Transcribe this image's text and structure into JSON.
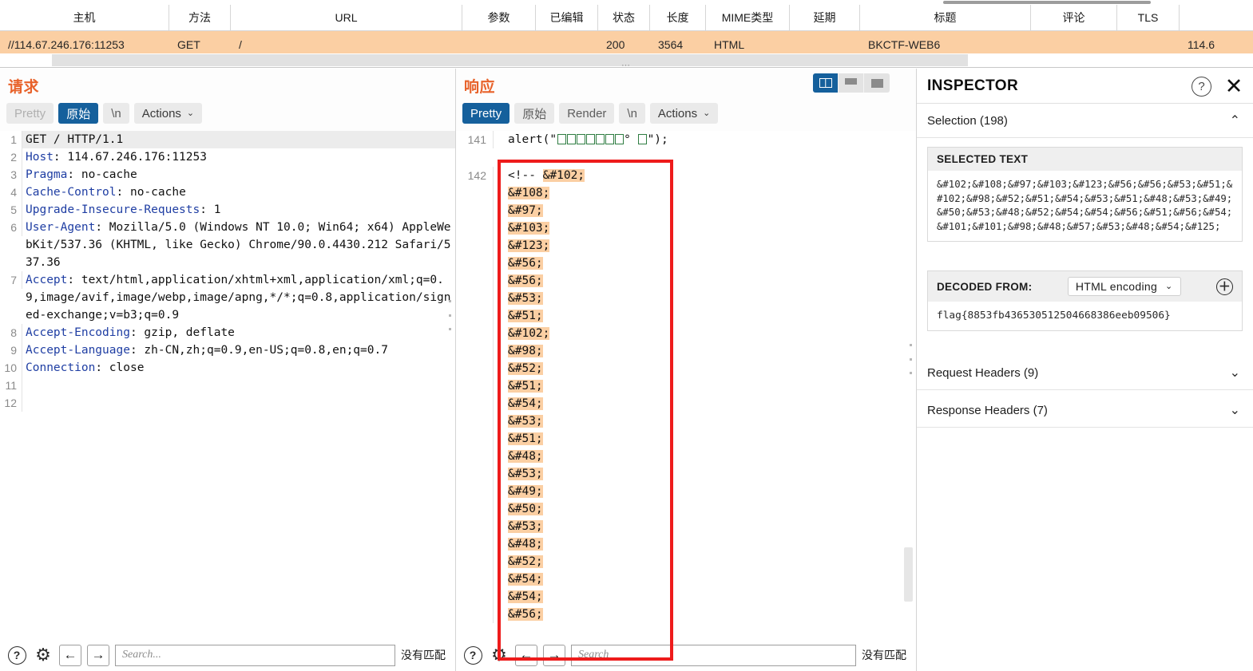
{
  "proxy_table": {
    "columns": [
      {
        "key": "host",
        "label": "主机"
      },
      {
        "key": "method",
        "label": "方法"
      },
      {
        "key": "url",
        "label": "URL"
      },
      {
        "key": "params",
        "label": "参数"
      },
      {
        "key": "edited",
        "label": "已编辑"
      },
      {
        "key": "status",
        "label": "状态"
      },
      {
        "key": "length",
        "label": "长度"
      },
      {
        "key": "mime",
        "label": "MIME类型"
      },
      {
        "key": "delay",
        "label": "延期"
      },
      {
        "key": "title",
        "label": "标题"
      },
      {
        "key": "comment",
        "label": "评论"
      },
      {
        "key": "tls",
        "label": "TLS"
      },
      {
        "key": "ip",
        "label": ""
      }
    ],
    "rows": [
      {
        "host": "//114.67.246.176:11253",
        "method": "GET",
        "url": "/",
        "params": "",
        "edited": "",
        "status": "200",
        "length": "3564",
        "mime": "HTML",
        "delay": "",
        "title": "BKCTF-WEB6",
        "comment": "",
        "tls": "",
        "ip": "114.6"
      }
    ]
  },
  "request_pane": {
    "title": "请求",
    "tabs": [
      {
        "label": "Pretty",
        "state": "dim"
      },
      {
        "label": "原始",
        "state": "active"
      },
      {
        "label": "\\n",
        "state": "normal"
      },
      {
        "label": "Actions",
        "state": "normal",
        "caret": "⌄"
      }
    ],
    "lines": [
      {
        "n": "1",
        "highlight": true,
        "segments": [
          {
            "t": "GET / HTTP/1.1",
            "cls": "plain"
          }
        ]
      },
      {
        "n": "2",
        "highlight": false,
        "segments": [
          {
            "t": "Host",
            "cls": "key"
          },
          {
            "t": ": 114.67.246.176:11253",
            "cls": "plain"
          }
        ]
      },
      {
        "n": "3",
        "highlight": false,
        "segments": [
          {
            "t": "Pragma",
            "cls": "key"
          },
          {
            "t": ": no-cache",
            "cls": "plain"
          }
        ]
      },
      {
        "n": "4",
        "highlight": false,
        "segments": [
          {
            "t": "Cache-Control",
            "cls": "key"
          },
          {
            "t": ": no-cache",
            "cls": "plain"
          }
        ]
      },
      {
        "n": "5",
        "highlight": false,
        "segments": [
          {
            "t": "Upgrade-Insecure-Requests",
            "cls": "key"
          },
          {
            "t": ": 1",
            "cls": "plain"
          }
        ]
      },
      {
        "n": "6",
        "highlight": false,
        "segments": [
          {
            "t": "User-Agent",
            "cls": "key"
          },
          {
            "t": ": Mozilla/5.0 (Windows NT 10.0; Win64; x64) AppleWebKit/537.36 (KHTML, like Gecko) Chrome/90.0.4430.212 Safari/537.36",
            "cls": "plain"
          }
        ]
      },
      {
        "n": "7",
        "highlight": false,
        "segments": [
          {
            "t": "Accept",
            "cls": "key"
          },
          {
            "t": ": text/html,application/xhtml+xml,application/xml;q=0.9,image/avif,image/webp,image/apng,*/*;q=0.8,application/signed-exchange;v=b3;q=0.9",
            "cls": "plain"
          }
        ]
      },
      {
        "n": "8",
        "highlight": false,
        "segments": [
          {
            "t": "Accept-Encoding",
            "cls": "key"
          },
          {
            "t": ": gzip, deflate",
            "cls": "plain"
          }
        ]
      },
      {
        "n": "9",
        "highlight": false,
        "segments": [
          {
            "t": "Accept-Language",
            "cls": "key"
          },
          {
            "t": ": zh-CN,zh;q=0.9,en-US;q=0.8,en;q=0.7",
            "cls": "plain"
          }
        ]
      },
      {
        "n": "10",
        "highlight": false,
        "segments": [
          {
            "t": "Connection",
            "cls": "key"
          },
          {
            "t": ": close",
            "cls": "plain"
          }
        ]
      },
      {
        "n": "11",
        "highlight": false,
        "segments": [
          {
            "t": "",
            "cls": "plain"
          }
        ]
      },
      {
        "n": "12",
        "highlight": false,
        "segments": [
          {
            "t": "",
            "cls": "plain"
          }
        ]
      }
    ],
    "search": {
      "placeholder": "Search...",
      "no_match_label": "没有匹配",
      "prev_icon": "←",
      "next_icon": "→",
      "help_icon": "?",
      "settings_icon": "⚙"
    }
  },
  "response_pane": {
    "title": "响应",
    "tabs": [
      {
        "label": "Pretty",
        "state": "active"
      },
      {
        "label": "原始",
        "state": "normal"
      },
      {
        "label": "Render",
        "state": "normal"
      },
      {
        "label": "\\n",
        "state": "normal"
      },
      {
        "label": "Actions",
        "state": "normal",
        "caret": "⌄"
      }
    ],
    "view_toggle": {
      "options": [
        "split-view",
        "stacked-view",
        "single-view"
      ],
      "active": "split-view"
    },
    "line_141": {
      "number": "141",
      "prefix": "alert(\"",
      "tofu_count_1": 7,
      "degree": "°",
      "tofu_count_2": 1,
      "suffix": "\");"
    },
    "line_142": {
      "number": "142",
      "comment_open": "<!--",
      "entities": [
        "&#102;",
        "&#108;",
        "&#97;",
        "&#103;",
        "&#123;",
        "&#56;",
        "&#56;",
        "&#53;",
        "&#51;",
        "&#102;",
        "&#98;",
        "&#52;",
        "&#51;",
        "&#54;",
        "&#53;",
        "&#51;",
        "&#48;",
        "&#53;",
        "&#49;",
        "&#50;",
        "&#53;",
        "&#48;",
        "&#52;",
        "&#54;",
        "&#54;",
        "&#56;"
      ]
    },
    "search": {
      "placeholder": "Search",
      "no_match_label": "没有匹配",
      "prev_icon": "←",
      "next_icon": "→",
      "help_icon": "?",
      "settings_icon": "⚙"
    }
  },
  "inspector": {
    "title": "INSPECTOR",
    "help_icon": "?",
    "close_icon": "✕",
    "selection": {
      "label": "Selection (198)",
      "chevron": "⌃",
      "selected_text_label": "SELECTED TEXT",
      "selected_text_value": "&#102;&#108;&#97;&#103;&#123;&#56;&#56;&#53;&#51;&#102;&#98;&#52;&#51;&#54;&#53;&#51;&#48;&#53;&#49;&#50;&#53;&#48;&#52;&#54;&#54;&#56;&#51;&#56;&#54;&#101;&#101;&#98;&#48;&#57;&#53;&#48;&#54;&#125;",
      "decoded_from_label": "DECODED FROM:",
      "decoder_selected": "HTML encoding",
      "decoder_caret": "⌄",
      "add_icon": "＋",
      "decoded_value": "flag{8853fb436530512504668386eeb09506}"
    },
    "request_headers": {
      "label": "Request Headers (9)",
      "chevron": "⌄"
    },
    "response_headers": {
      "label": "Response Headers (7)",
      "chevron": "⌄"
    }
  },
  "colors": {
    "row_highlight": "#fbcfa3",
    "pane_title": "#e8622a",
    "active_tab": "#15609c",
    "entity_highlight": "#fbcfa3",
    "red_box": "#ee1b1b"
  }
}
